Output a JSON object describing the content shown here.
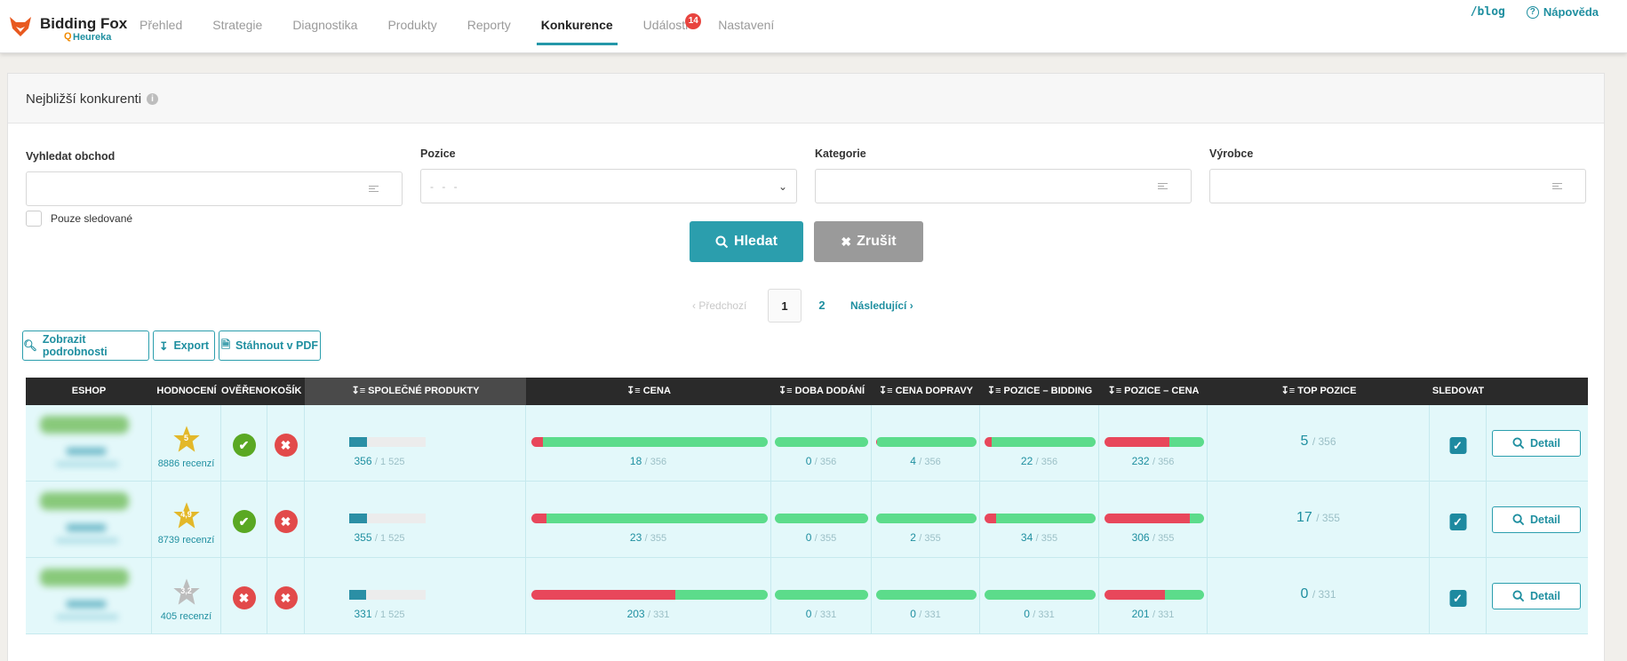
{
  "app": {
    "logo_title": "Bidding Fox",
    "logo_sub": "Heureka",
    "accent_color": "#2b9ead"
  },
  "nav": {
    "items": [
      {
        "label": "Přehled",
        "active": false,
        "badge": ""
      },
      {
        "label": "Strategie",
        "active": false,
        "badge": ""
      },
      {
        "label": "Diagnostika",
        "active": false,
        "badge": ""
      },
      {
        "label": "Produkty",
        "active": false,
        "badge": ""
      },
      {
        "label": "Reporty",
        "active": false,
        "badge": ""
      },
      {
        "label": "Konkurence",
        "active": true,
        "badge": ""
      },
      {
        "label": "Události",
        "active": false,
        "badge": "14"
      },
      {
        "label": "Nastavení",
        "active": false,
        "badge": ""
      }
    ],
    "blog_label": "/blog",
    "help_label": "Nápověda"
  },
  "panel": {
    "title": "Nejbližší konkurenti"
  },
  "filters": {
    "shop_label": "Vyhledat obchod",
    "position_label": "Pozice",
    "position_placeholder": "- - -",
    "category_label": "Kategorie",
    "manufacturer_label": "Výrobce",
    "only_followed_label": "Pouze sledované",
    "search_label": "Hledat",
    "cancel_label": "Zrušit"
  },
  "pagination": {
    "prev_label": "Předchozí",
    "current_page": "1",
    "other_page": "2",
    "next_label": "Následující"
  },
  "toolbar": {
    "details_label": "Zobrazit podrobnosti",
    "export_label": "Export",
    "pdf_label": "Stáhnout v PDF"
  },
  "table": {
    "headers": {
      "eshop": "Eshop",
      "rating": "Hodnocení",
      "verified": "Ověřeno",
      "cart": "Košík",
      "common_products": "Společné produkty",
      "price": "Cena",
      "delivery_time": "Doba dodání",
      "shipping_price": "Cena dopravy",
      "position_bidding": "Pozice – Bidding",
      "position_price": "Pozice – Cena",
      "top_position": "Top pozice",
      "follow": "Sledovat"
    },
    "detail_label": "Detail",
    "rows": [
      {
        "rating": "5",
        "star_color": "#e3b829",
        "reviews": "8886 recenzí",
        "verified": true,
        "cart": false,
        "common": "356",
        "common_total": "/ 1 525",
        "common_fraction": 0.23,
        "price": "18",
        "price_total": "/ 356",
        "price_red": 0.05,
        "delivery": "0",
        "delivery_total": "/ 356",
        "delivery_red": 0.0,
        "shipping": "4",
        "shipping_total": "/ 356",
        "shipping_red": 0.01,
        "pos_bidding": "22",
        "pos_bidding_total": "/ 356",
        "pos_bidding_red": 0.06,
        "pos_price": "232",
        "pos_price_total": "/ 356",
        "pos_price_red": 0.65,
        "top": "5",
        "top_total": "/ 356",
        "followed": true
      },
      {
        "rating": "4,9",
        "star_color": "#e3b829",
        "reviews": "8739 recenzí",
        "verified": true,
        "cart": false,
        "common": "355",
        "common_total": "/ 1 525",
        "common_fraction": 0.23,
        "price": "23",
        "price_total": "/ 355",
        "price_red": 0.065,
        "delivery": "0",
        "delivery_total": "/ 355",
        "delivery_red": 0.0,
        "shipping": "2",
        "shipping_total": "/ 355",
        "shipping_red": 0.0,
        "pos_bidding": "34",
        "pos_bidding_total": "/ 355",
        "pos_bidding_red": 0.1,
        "pos_price": "306",
        "pos_price_total": "/ 355",
        "pos_price_red": 0.86,
        "top": "17",
        "top_total": "/ 355",
        "followed": true
      },
      {
        "rating": "3,2",
        "star_color": "#bdbdbd",
        "reviews": "405 recenzí",
        "verified": false,
        "cart": false,
        "common": "331",
        "common_total": "/ 1 525",
        "common_fraction": 0.22,
        "price": "203",
        "price_total": "/ 331",
        "price_red": 0.61,
        "delivery": "0",
        "delivery_total": "/ 331",
        "delivery_red": 0.0,
        "shipping": "0",
        "shipping_total": "/ 331",
        "shipping_red": 0.0,
        "pos_bidding": "0",
        "pos_bidding_total": "/ 331",
        "pos_bidding_red": 0.0,
        "pos_price": "201",
        "pos_price_total": "/ 331",
        "pos_price_red": 0.61,
        "top": "0",
        "top_total": "/ 331",
        "followed": true
      }
    ]
  }
}
